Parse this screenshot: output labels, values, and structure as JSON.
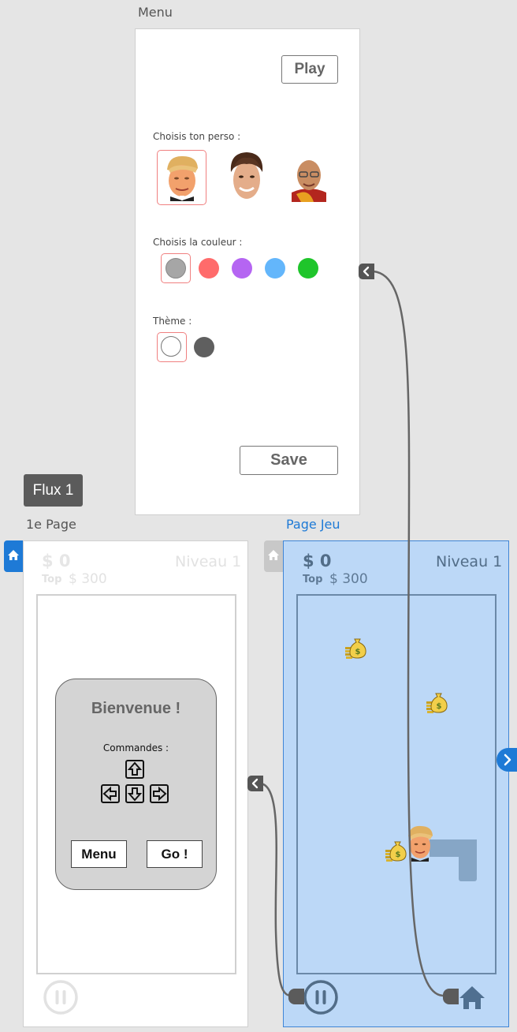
{
  "menu_screen": {
    "frame_label": "Menu",
    "play_label": "Play",
    "character_label": "Choisis ton perso :",
    "characters": [
      "face-trump",
      "face-man",
      "face-monk"
    ],
    "color_label": "Choisis la couleur :",
    "colors": [
      "#a6a6a6",
      "#ff6b6b",
      "#b565f2",
      "#63b6fb",
      "#1fc52b"
    ],
    "theme_label": "Thème :",
    "themes": [
      "#ffffff",
      "#5f5f5f"
    ],
    "save_label": "Save"
  },
  "flow": {
    "tag": "Flux 1"
  },
  "first_page": {
    "frame_label": "1e Page",
    "money": "$ 0",
    "top_label": "Top",
    "top_value": "$ 300",
    "level": "Niveau 1",
    "welcome_title": "Bienvenue !",
    "commands_label": "Commandes :",
    "menu_button": "Menu",
    "go_button": "Go !"
  },
  "game_page": {
    "frame_label": "Page Jeu",
    "money": "$ 0",
    "top_label": "Top",
    "top_value": "$ 300",
    "level": "Niveau 1"
  },
  "colors": {
    "accent": "#1e7ad6",
    "selection": "#f08080",
    "game_bg": "#bcd8f7"
  }
}
